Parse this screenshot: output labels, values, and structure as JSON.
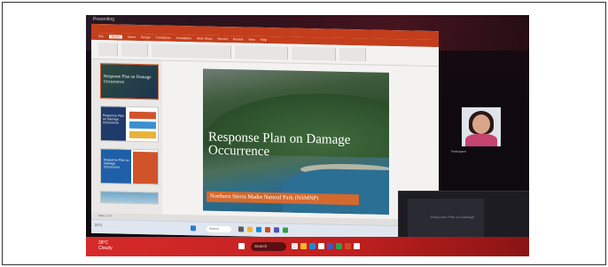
{
  "laptop": {
    "window_title": "Presenting",
    "ribbon_tabs": [
      "File",
      "Home",
      "Insert",
      "Design",
      "Transitions",
      "Animations",
      "Slide Show",
      "Record",
      "Review",
      "View",
      "Help"
    ],
    "slide": {
      "title": "Response Plan on Damage Occurrence",
      "banner": "Northern Sierra Madre Natural Park (NSMNP)"
    },
    "thumb1_text": "Response Plan on Damage Occurrence",
    "thumb2_text": "Response Plan on Damage Occurrence",
    "thumb3_text": "Response Plan on Damage Occurrence",
    "status_text": "Slide 1 of 4",
    "taskbar_weather": "31°C",
    "taskbar_search": "Search"
  },
  "participant": {
    "name_tag": "Participant"
  },
  "monitor2": {
    "screen_text": "Response Plan on Damage"
  },
  "bottom_taskbar": {
    "weather_temp": "28°C",
    "weather_desc": "Cloudy",
    "search_label": "Search"
  },
  "colors": {
    "powerpoint_red": "#c43e1c",
    "banner_orange": "#d4692e",
    "taskbar_red": "#d62a2a"
  }
}
